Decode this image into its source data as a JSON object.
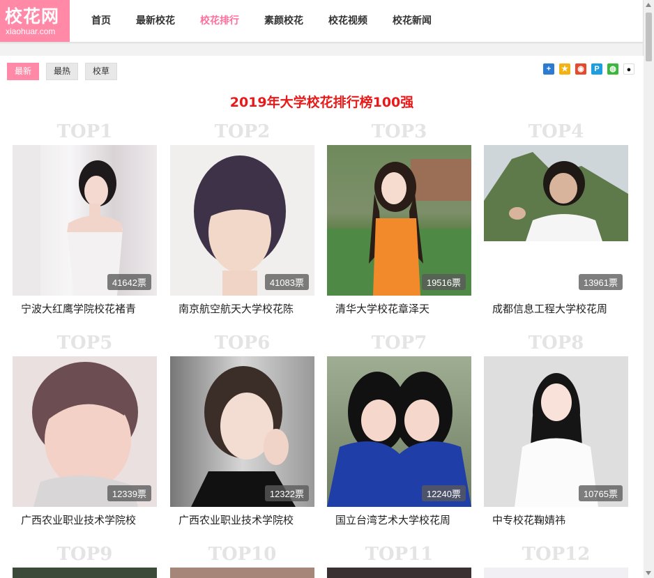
{
  "logo": {
    "text": "校花网",
    "domain": "xiaohuar.com"
  },
  "nav": [
    "首页",
    "最新校花",
    "校花排行",
    "素颜校花",
    "校花视频",
    "校花新闻"
  ],
  "filters": [
    "最新",
    "最热",
    "校草"
  ],
  "page_title": "2019年大学校花排行榜100强",
  "cards": [
    {
      "rank": "TOP1",
      "votes": "41642票",
      "name": "宁波大红鹰学院校花褚青"
    },
    {
      "rank": "TOP2",
      "votes": "41083票",
      "name": "南京航空航天大学校花陈"
    },
    {
      "rank": "TOP3",
      "votes": "19516票",
      "name": "清华大学校花章泽天"
    },
    {
      "rank": "TOP4",
      "votes": "13961票",
      "name": "成都信息工程大学校花周"
    },
    {
      "rank": "TOP5",
      "votes": "12339票",
      "name": "广西农业职业技术学院校"
    },
    {
      "rank": "TOP6",
      "votes": "12322票",
      "name": "广西农业职业技术学院校"
    },
    {
      "rank": "TOP7",
      "votes": "12240票",
      "name": "国立台湾艺术大学校花周"
    },
    {
      "rank": "TOP8",
      "votes": "10765票",
      "name": "中专校花鞠婧祎"
    },
    {
      "rank": "TOP9",
      "votes": "",
      "name": ""
    },
    {
      "rank": "TOP10",
      "votes": "",
      "name": ""
    },
    {
      "rank": "TOP11",
      "votes": "",
      "name": ""
    },
    {
      "rank": "TOP12",
      "votes": "",
      "name": ""
    }
  ]
}
